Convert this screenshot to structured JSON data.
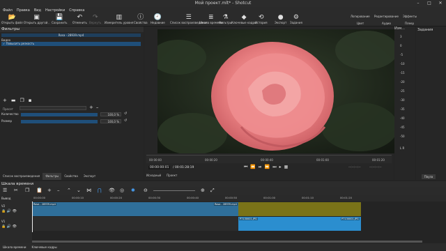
{
  "window": {
    "title": "Мой проект.mlt* - Shotcut",
    "controls": [
      "–",
      "□",
      "✕"
    ]
  },
  "menu": [
    "Файл",
    "Правка",
    "Вид",
    "Настройки",
    "Справка"
  ],
  "toolbar": {
    "items": [
      {
        "label": "Открыть файл",
        "icon": "open-file-icon",
        "glyph": "📂",
        "enabled": true
      },
      {
        "label": "Открыть другой..",
        "icon": "open-other-icon",
        "glyph": "▣",
        "enabled": true
      },
      {
        "label": "Сохранить",
        "icon": "save-icon",
        "glyph": "💾",
        "enabled": true
      },
      {
        "label": "Отменить",
        "icon": "undo-icon",
        "glyph": "↶",
        "enabled": true
      },
      {
        "label": "Вернуть",
        "icon": "redo-icon",
        "glyph": "↷",
        "enabled": false
      },
      {
        "label": "Измеритель уровня",
        "icon": "peak-meter-icon",
        "glyph": "▥",
        "enabled": true
      },
      {
        "label": "Свойства",
        "icon": "properties-icon",
        "glyph": "ⓘ",
        "enabled": true
      },
      {
        "label": "Недавние",
        "icon": "recent-icon",
        "glyph": "🕘",
        "enabled": true
      },
      {
        "label": "Список воспроизведения",
        "icon": "playlist-icon",
        "glyph": "☰",
        "enabled": true
      },
      {
        "label": "Шкала времени",
        "icon": "timeline-icon",
        "glyph": "≣",
        "enabled": true
      },
      {
        "label": "Фильтры",
        "icon": "filters-icon",
        "glyph": "⚗",
        "enabled": true
      },
      {
        "label": "Ключевые кадры",
        "icon": "keyframes-icon",
        "glyph": "◆",
        "enabled": true
      },
      {
        "label": "История",
        "icon": "history-icon",
        "glyph": "⟲",
        "enabled": true
      },
      {
        "label": "Экспорт",
        "icon": "export-icon",
        "glyph": "●",
        "enabled": true
      },
      {
        "label": "Задания",
        "icon": "jobs-icon",
        "glyph": "⚙",
        "enabled": true
      }
    ],
    "layouts_top": [
      "Логирование",
      "Редактирование",
      "Эффекты"
    ],
    "layouts_bottom": [
      "Цвет",
      "Аудио",
      "Плеер"
    ]
  },
  "filters_panel": {
    "title": "Фильтры",
    "file_name": "Rosa - 28939.mp4",
    "section": "Видео",
    "filter_item": "✓ Повысить резкость",
    "preset_label": "Пресет",
    "params": [
      {
        "label": "Количество",
        "value": "100,0 %",
        "fraction": 1.0
      },
      {
        "label": "Размер",
        "value": "100,0 %",
        "fraction": 1.0
      }
    ]
  },
  "left_tabs": [
    "Список воспроизведения",
    "Фильтры",
    "Свойства",
    "Экспорт"
  ],
  "player": {
    "ruler_ticks": [
      "00:00:00",
      "00:00:20",
      "00:00:40",
      "00:01:00",
      "00:01:20"
    ],
    "current_time": "00:00:00:01",
    "total_time": "/ 00:01:28:19",
    "in_point": "--:--:--:--",
    "out_point": "--:--:--:--",
    "source_tabs": [
      "Исходный",
      "Проект"
    ]
  },
  "meter": {
    "title": "Изм...",
    "scale": [
      "3",
      "0",
      "-5",
      "-10",
      "-15",
      "-20",
      "-25",
      "-30",
      "-35",
      "-40",
      "-45",
      "-50"
    ],
    "footer": "L R"
  },
  "jobs": {
    "title": "Задания",
    "pause_label": "Пауза"
  },
  "timeline": {
    "title": "Шкала времени",
    "ruler_ticks": [
      "00:00:00",
      "00:00:10",
      "00:00:20",
      "00:00:30",
      "00:00:40",
      "00:00:50",
      "00:01:00",
      "00:01:10",
      "00:01:20"
    ],
    "output_label": "Вывод",
    "tracks": [
      {
        "name": "V2",
        "clips": [
          {
            "label": "Rosa - 28939.mp4",
            "color": "#2f6f9a"
          },
          {
            "label": "Rosa - 28939.mp4",
            "color": "#2f6f9a"
          }
        ]
      },
      {
        "name": "V1",
        "clips": [
          {
            "label": "P7130001.JPG",
            "color": "#2b8ecf"
          },
          {
            "label": "P7130001.JPG",
            "color": "#2b8ecf"
          }
        ]
      }
    ],
    "empty_region_color": "#7a7318"
  },
  "footer_tabs": [
    "Шкала времени",
    "Ключевые кадры"
  ]
}
